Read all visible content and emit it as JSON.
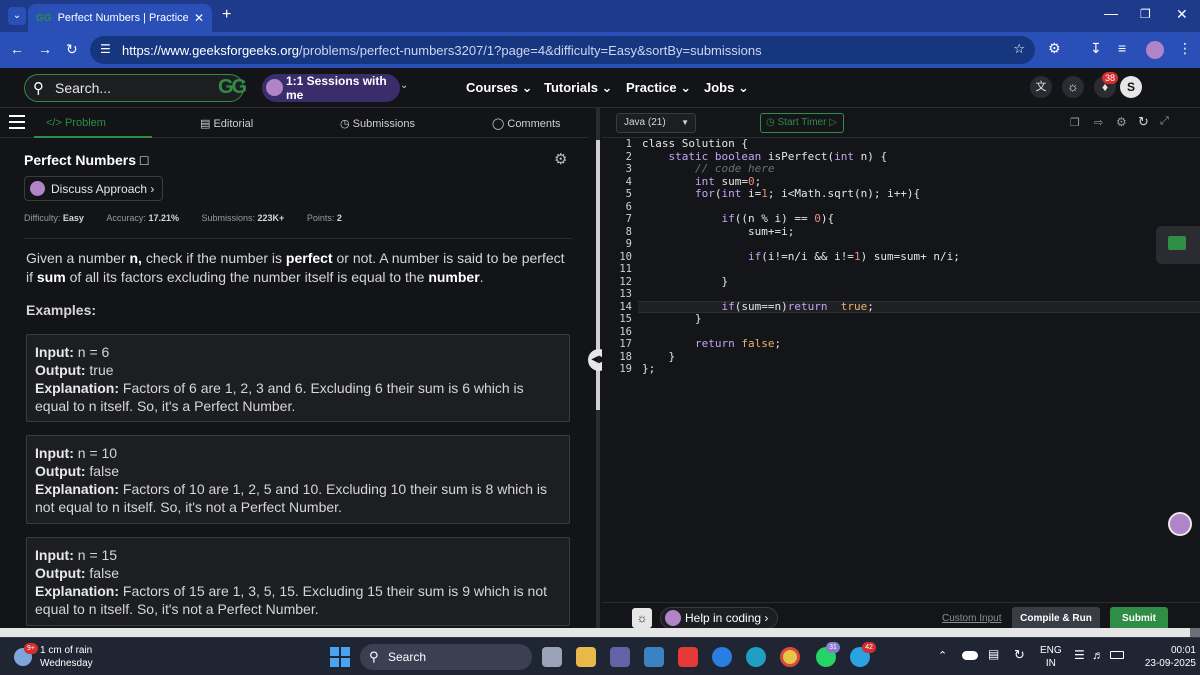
{
  "browser": {
    "tab_title": "Perfect Numbers | Practice | Ge",
    "url_host": "https://www.geeksforgeeks.org",
    "url_path": "/problems/perfect-numbers3207/1?page=4&difficulty=Easy&sortBy=submissions"
  },
  "site_nav": {
    "search_placeholder": "Search...",
    "logo": "GG",
    "sessions_label": "1:1 Sessions with me",
    "links": [
      "Courses",
      "Tutorials",
      "Practice",
      "Jobs"
    ],
    "notification_count": "38",
    "avatar_letter": "S"
  },
  "left_tabs": [
    "</> Problem",
    "Editorial",
    "Submissions",
    "Comments"
  ],
  "problem": {
    "title": "Perfect Numbers",
    "discuss_label": "Discuss Approach",
    "difficulty_label": "Difficulty:",
    "difficulty": "Easy",
    "accuracy_label": "Accuracy:",
    "accuracy": "17.21%",
    "submissions_label": "Submissions:",
    "submissions": "223K+",
    "points_label": "Points:",
    "points": "2",
    "desc_1": "Given a number ",
    "desc_n": "n,",
    "desc_2": " check if the number is ",
    "desc_perfect": "perfect",
    "desc_3": " or not. A number is said to be perfect if ",
    "desc_sum": "sum",
    "desc_4": " of all its factors excluding the number itself is equal to the ",
    "desc_number": "number",
    "desc_5": ".",
    "examples_label": "Examples:",
    "examples": [
      {
        "input_label": "Input:",
        "input": "n = 6",
        "output_label": "Output:",
        "output": "true",
        "expl_label": "Explanation:",
        "expl": "Factors of 6 are 1, 2, 3 and 6. Excluding 6 their sum is 6 which is equal to n itself. So, it's a Perfect Number."
      },
      {
        "input_label": "Input:",
        "input": "n = 10",
        "output_label": "Output:",
        "output": "false",
        "expl_label": "Explanation:",
        "expl": "Factors of 10 are 1, 2, 5 and 10. Excluding 10 their sum is 8 which is not equal to n itself. So, it's not a Perfect Number."
      },
      {
        "input_label": "Input:",
        "input": "n = 15",
        "output_label": "Output:",
        "output": "false",
        "expl_label": "Explanation:",
        "expl": "Factors of 15 are 1, 3, 5, 15. Excluding 15 their sum is 9 which is not equal to n itself. So, it's not a Perfect Number."
      }
    ]
  },
  "editor": {
    "language": "Java (21)",
    "start_timer": "Start Timer",
    "line_numbers": [
      "1",
      "2",
      "3",
      "4",
      "5",
      "6",
      "7",
      "8",
      "9",
      "10",
      "11",
      "12",
      "13",
      "14",
      "15",
      "16",
      "17",
      "18",
      "19"
    ],
    "help_label": "Help in coding",
    "custom_input": "Custom Input",
    "compile_run": "Compile & Run",
    "submit": "Submit"
  },
  "taskbar": {
    "weather_badge": "9+",
    "weather_line1": "1 cm of rain",
    "weather_line2": "Wednesday",
    "search_label": "Search",
    "whatsapp_badge": "31",
    "telegram_badge": "42",
    "lang_line1": "ENG",
    "lang_line2": "IN",
    "time": "00:01",
    "date": "23-09-2025"
  },
  "colors": {
    "gfg_green": "#2f8d46",
    "tab_strip": "#1e3a8a",
    "address_row": "#2a50b8",
    "page_bg": "#131417",
    "submit_green": "#2f8d46",
    "compile_grey": "#3a3d45"
  }
}
